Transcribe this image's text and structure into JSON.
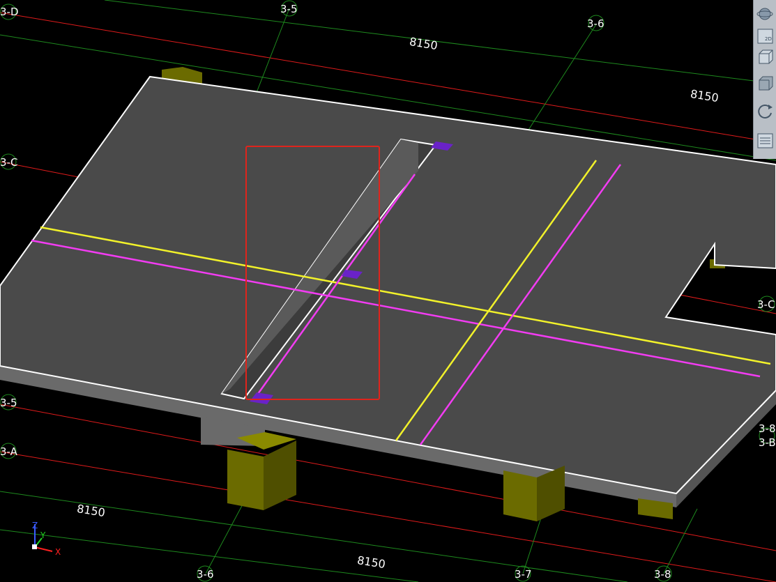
{
  "grid_labels": {
    "d_left": "3-D",
    "c_left": "3-C",
    "b_left": "3-5",
    "a_left": "3-A",
    "col_5_top": "3-5",
    "col_6_top": "3-6",
    "col_6_bottom": "3-6",
    "col_7_bottom": "3-7",
    "col_8_bottom": "3-8",
    "c_right": "3-C",
    "b_right_upper": "3-8",
    "b_right_lower": "3-B"
  },
  "dimensions": {
    "top_center": "8150",
    "top_right": "8150",
    "bottom_left": "8150",
    "bottom_center": "8150"
  },
  "axis_gizmo": {
    "x": "X",
    "y": "Y",
    "z": "Z"
  },
  "view_toolbar": {
    "buttons": [
      "orbit-icon",
      "2d-view-icon",
      "3d-view-icon",
      "box-view-icon",
      "rotate-icon",
      "properties-icon"
    ],
    "label_2d": "2D"
  },
  "colors": {
    "background": "#000000",
    "slab": "#4a4a4a",
    "column": "#6b6b00",
    "grid_red": "#e01b1b",
    "grid_green": "#1e8a1e",
    "beam_yellow": "#f2f22a",
    "beam_magenta": "#f23cf2",
    "highlight": "#e0241c",
    "marker": "#6a22c8"
  }
}
